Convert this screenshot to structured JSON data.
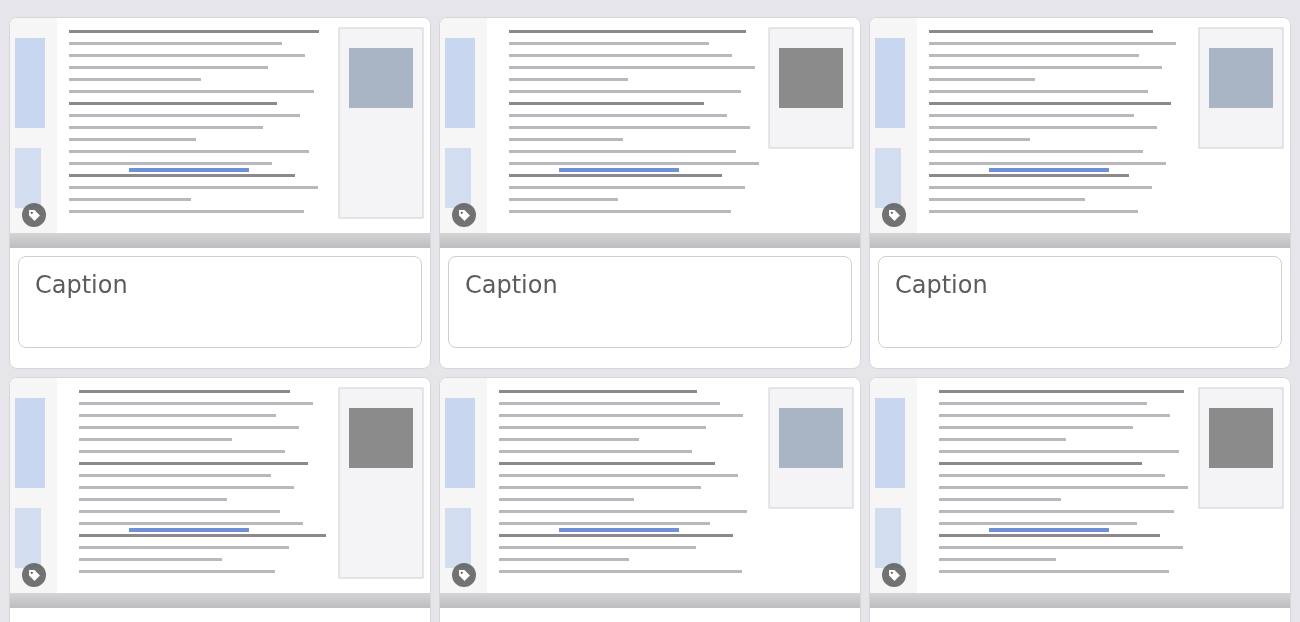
{
  "cards": [
    {
      "thumbnail": {
        "kind": "picture"
      },
      "caption": {
        "placeholder": "Caption"
      }
    },
    {
      "thumbnail": {
        "kind": "picture"
      },
      "caption": {
        "placeholder": "Caption"
      }
    },
    {
      "thumbnail": {
        "kind": "picture"
      },
      "caption": {
        "placeholder": "Caption"
      }
    },
    {
      "thumbnail": {
        "kind": "picture"
      }
    },
    {
      "thumbnail": {
        "kind": "picture"
      }
    },
    {
      "thumbnail": {
        "kind": "picture"
      }
    }
  ]
}
